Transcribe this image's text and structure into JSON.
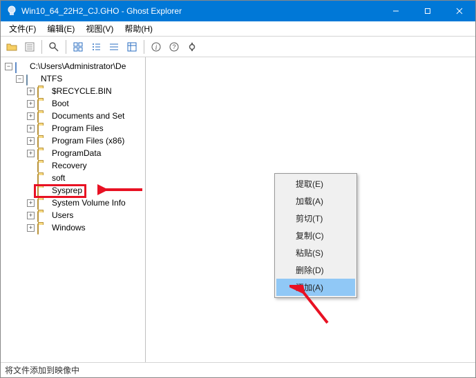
{
  "titlebar": {
    "title": "Win10_64_22H2_CJ.GHO - Ghost Explorer"
  },
  "menu": {
    "file": "文件(F)",
    "edit": "编辑(E)",
    "view": "视图(V)",
    "help": "帮助(H)"
  },
  "tree": {
    "root": "C:\\Users\\Administrator\\De",
    "disk": "NTFS",
    "items": [
      "$RECYCLE.BIN",
      "Boot",
      "Documents and Set",
      "Program Files",
      "Program Files (x86)",
      "ProgramData",
      "Recovery",
      "soft",
      "Sysprep",
      "System Volume Info",
      "Users",
      "Windows"
    ]
  },
  "context_menu": {
    "items": [
      "提取(E)",
      "加载(A)",
      "剪切(T)",
      "复制(C)",
      "粘贴(S)",
      "删除(D)",
      "添加(A)"
    ]
  },
  "statusbar": {
    "text": "将文件添加到映像中"
  },
  "watermark": "",
  "annotation": {
    "highlighted_tree_item": "soft",
    "highlighted_menu_item": "添加(A)"
  }
}
